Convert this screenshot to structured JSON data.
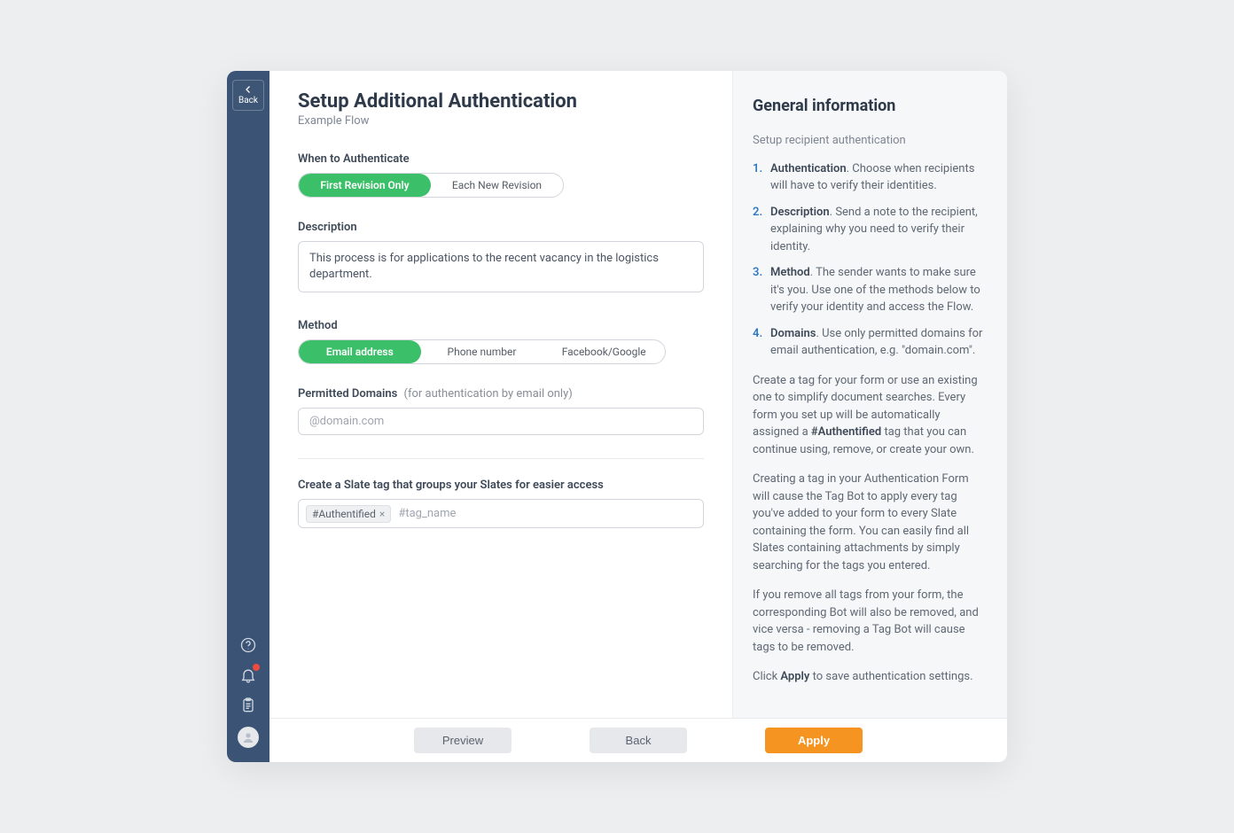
{
  "sidebar": {
    "back_label": "Back"
  },
  "header": {
    "title": "Setup Additional Authentication",
    "subtitle": "Example Flow"
  },
  "when": {
    "label": "When to Authenticate",
    "options": [
      "First Revision Only",
      "Each New Revision"
    ],
    "selected": 0
  },
  "description": {
    "label": "Description",
    "value": "This process is for applications to the recent vacancy in the logistics department."
  },
  "method": {
    "label": "Method",
    "options": [
      "Email address",
      "Phone number",
      "Facebook/Google"
    ],
    "selected": 0
  },
  "domains": {
    "label": "Permitted Domains",
    "hint": "(for authentication by email only)",
    "placeholder": "@domain.com",
    "value": ""
  },
  "tags": {
    "label": "Create a Slate tag that groups your Slates for easier access",
    "chip": "#Authentified",
    "placeholder": "#tag_name"
  },
  "info": {
    "title": "General information",
    "subtitle": "Setup recipient authentication",
    "steps": [
      {
        "bold": "Authentication",
        "rest": ". Choose when recipients will have to verify their identities."
      },
      {
        "bold": "Description",
        "rest": ". Send a note to the recipient, explaining why you need to verify their identity."
      },
      {
        "bold": "Method",
        "rest": ". The sender wants to make sure it's you. Use one of the methods below to verify your identity and access the Flow."
      },
      {
        "bold": "Domains",
        "rest": ". Use only permitted domains for email authentication, e.g. \"domain.com\"."
      }
    ],
    "p1_a": "Create a tag for your form or use an existing one to simplify document searches. Every form you set up will be automatically assigned a ",
    "p1_bold": "#Authentified",
    "p1_b": " tag that you can continue using, remove, or create your own.",
    "p2": "Creating a tag in your Authentication Form will cause the Tag Bot to apply every tag you've added to your form to every Slate containing the form. You can easily find all Slates containing attachments by simply searching for the tags you entered.",
    "p3": "If you remove all tags from your form, the corresponding Bot will also be removed, and vice versa - removing a Tag Bot will cause tags to be removed.",
    "p4_a": "Click ",
    "p4_bold": "Apply",
    "p4_b": " to save authentication settings."
  },
  "footer": {
    "preview": "Preview",
    "back": "Back",
    "apply": "Apply"
  }
}
